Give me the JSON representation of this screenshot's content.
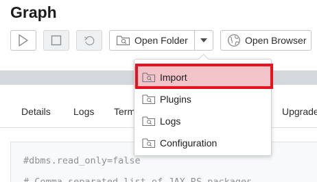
{
  "page": {
    "title": "Graph"
  },
  "toolbar": {
    "start_label": "Start",
    "stop_label": "Stop",
    "restart_label": "Restart",
    "open_folder_label": "Open Folder",
    "open_browser_label": "Open Browser"
  },
  "tabs": [
    {
      "label": "Details"
    },
    {
      "label": "Logs"
    },
    {
      "label": "Term"
    },
    {
      "label": "Upgrade"
    }
  ],
  "config": {
    "line1": "#dbms.read_only=false",
    "line2": "# Comma separated list of JAX-RS packages"
  },
  "open_folder_menu": {
    "items": [
      {
        "label": "Import",
        "icon": "folder-icon",
        "highlighted": true
      },
      {
        "label": "Plugins",
        "icon": "folder-icon"
      },
      {
        "label": "Logs",
        "icon": "folder-icon"
      },
      {
        "label": "Configuration",
        "icon": "folder-icon"
      }
    ]
  },
  "colors": {
    "highlight_fill": "#f2c3c8",
    "highlight_border": "#e8121f",
    "band_gray": "#d5d8db"
  }
}
